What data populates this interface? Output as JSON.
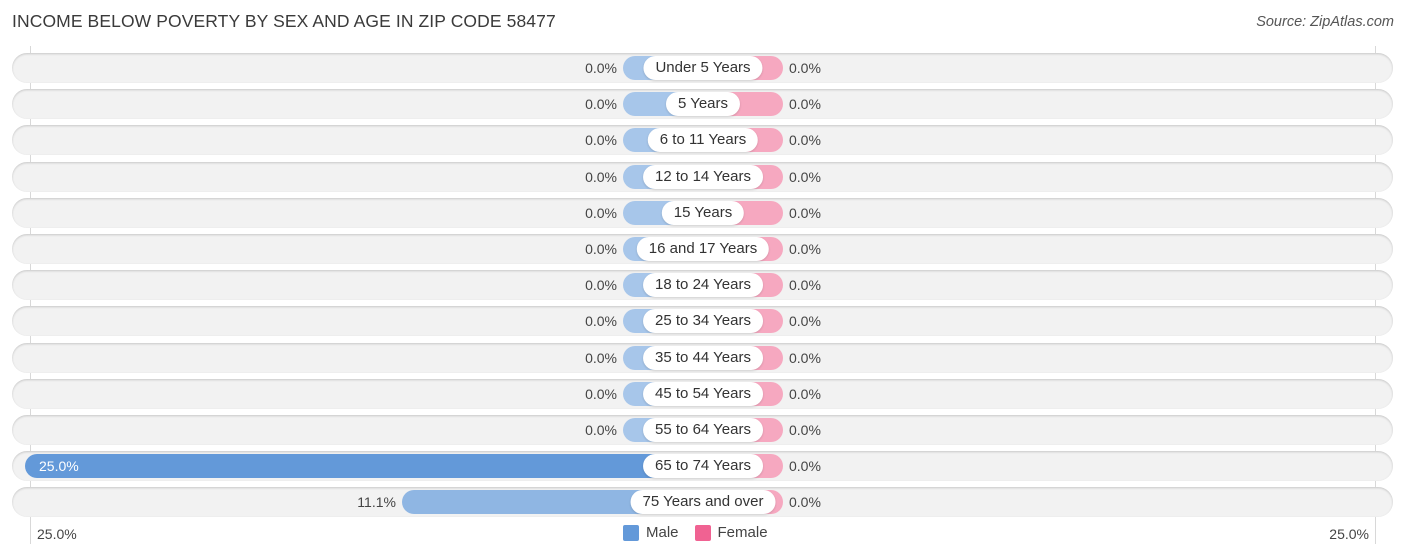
{
  "title": "INCOME BELOW POVERTY BY SEX AND AGE IN ZIP CODE 58477",
  "source": "Source: ZipAtlas.com",
  "colors": {
    "male": "#a7c6ea",
    "male_highlight": "#6399d9",
    "female": "#f6a8c0",
    "legend_male": "#6399d9",
    "legend_female": "#f06292"
  },
  "axis": {
    "left_label": "25.0%",
    "right_label": "25.0%"
  },
  "legend": {
    "male": "Male",
    "female": "Female"
  },
  "chart_data": {
    "type": "bar",
    "orientation": "horizontal-diverging",
    "title": "INCOME BELOW POVERTY BY SEX AND AGE IN ZIP CODE 58477",
    "categories": [
      "Under 5 Years",
      "5 Years",
      "6 to 11 Years",
      "12 to 14 Years",
      "15 Years",
      "16 and 17 Years",
      "18 to 24 Years",
      "25 to 34 Years",
      "35 to 44 Years",
      "45 to 54 Years",
      "55 to 64 Years",
      "65 to 74 Years",
      "75 Years and over"
    ],
    "series": [
      {
        "name": "Male",
        "values": [
          0.0,
          0.0,
          0.0,
          0.0,
          0.0,
          0.0,
          0.0,
          0.0,
          0.0,
          0.0,
          0.0,
          25.0,
          11.1
        ],
        "labels": [
          "0.0%",
          "0.0%",
          "0.0%",
          "0.0%",
          "0.0%",
          "0.0%",
          "0.0%",
          "0.0%",
          "0.0%",
          "0.0%",
          "0.0%",
          "25.0%",
          "11.1%"
        ]
      },
      {
        "name": "Female",
        "values": [
          0.0,
          0.0,
          0.0,
          0.0,
          0.0,
          0.0,
          0.0,
          0.0,
          0.0,
          0.0,
          0.0,
          0.0,
          0.0
        ],
        "labels": [
          "0.0%",
          "0.0%",
          "0.0%",
          "0.0%",
          "0.0%",
          "0.0%",
          "0.0%",
          "0.0%",
          "0.0%",
          "0.0%",
          "0.0%",
          "0.0%",
          "0.0%"
        ]
      }
    ],
    "xlim": [
      -25.0,
      25.0
    ],
    "xtick_labels": [
      "25.0%",
      "25.0%"
    ],
    "legend_position": "bottom-center",
    "grid": false
  }
}
